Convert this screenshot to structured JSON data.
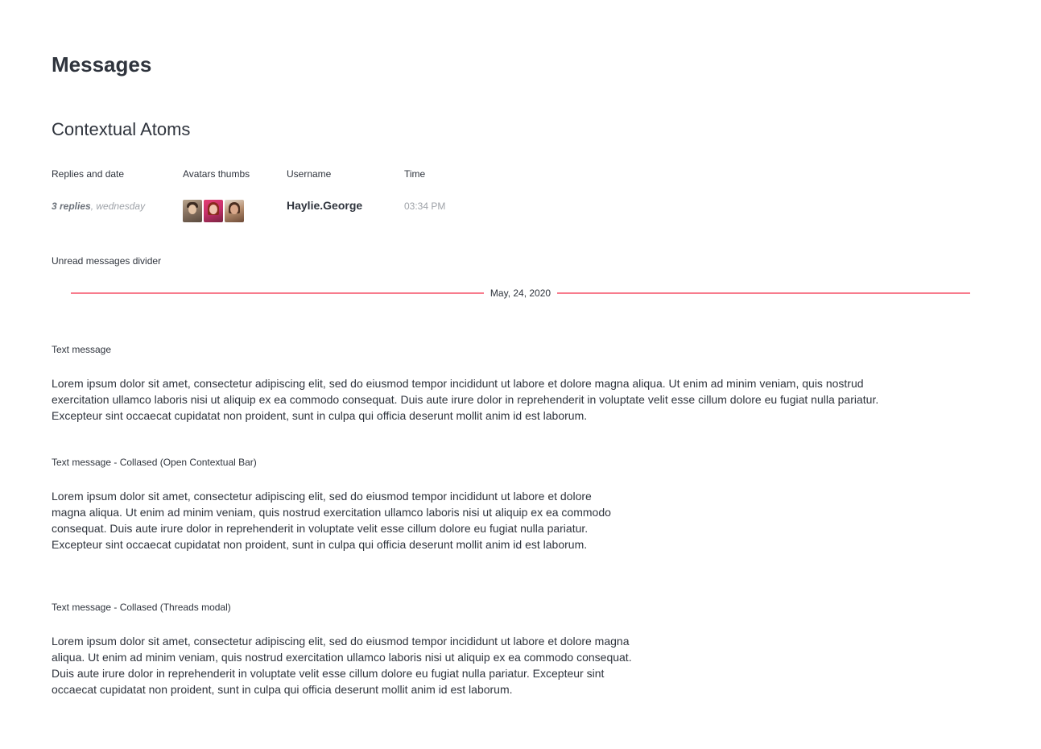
{
  "page": {
    "title": "Messages",
    "section_title": "Contextual Atoms"
  },
  "atoms": {
    "replies_label": "Replies and date",
    "avatars_label": "Avatars thumbs",
    "username_label": "Username",
    "time_label": "Time",
    "replies_count": "3 replies",
    "replies_separator": ", ",
    "replies_date": "wednesday",
    "avatars": [
      "user-avatar-1",
      "user-avatar-2",
      "user-avatar-3"
    ],
    "username": "Haylie.George",
    "time": "03:34 PM"
  },
  "divider": {
    "label": "Unread messages divider",
    "date": "May, 24, 2020",
    "color": "#f5455c"
  },
  "messages": [
    {
      "label": "Text message",
      "text": "Lorem ipsum dolor sit amet, consectetur adipiscing elit, sed do eiusmod tempor incididunt ut labore et dolore magna aliqua. Ut enim ad minim veniam, quis nostrud exercitation ullamco laboris nisi ut aliquip ex ea commodo consequat. Duis aute irure dolor in reprehenderit in voluptate velit esse cillum dolore eu fugiat nulla pariatur. Excepteur sint occaecat cupidatat non proident, sunt in culpa qui officia deserunt mollit anim id est laborum."
    },
    {
      "label": "Text message - Collased (Open Contextual Bar)",
      "text": "Lorem ipsum dolor sit amet, consectetur adipiscing elit, sed do eiusmod tempor incididunt ut labore et dolore magna aliqua. Ut enim ad minim veniam, quis nostrud exercitation ullamco laboris nisi ut aliquip ex ea commodo consequat. Duis aute irure dolor in reprehenderit in voluptate velit esse cillum dolore eu fugiat nulla pariatur. Excepteur sint occaecat cupidatat non proident, sunt in culpa qui officia deserunt mollit anim id est laborum."
    },
    {
      "label": "Text message - Collased (Threads modal)",
      "text": "Lorem ipsum dolor sit amet, consectetur adipiscing elit, sed do eiusmod tempor incididunt ut labore et dolore magna aliqua. Ut enim ad minim veniam, quis nostrud exercitation ullamco laboris nisi ut aliquip ex ea commodo consequat. Duis aute irure dolor in reprehenderit in voluptate velit esse cillum dolore eu fugiat nulla pariatur. Excepteur sint occaecat cupidatat non proident, sunt in culpa qui officia deserunt mollit anim id est laborum."
    }
  ]
}
